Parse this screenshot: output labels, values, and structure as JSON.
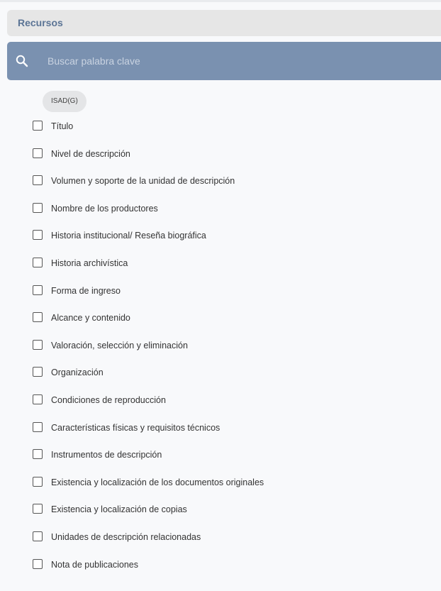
{
  "section": {
    "title": "Recursos"
  },
  "search": {
    "placeholder": "Buscar palabra clave",
    "icon": "search-icon"
  },
  "filter_chip": {
    "label": "ISAD(G)"
  },
  "fields": [
    {
      "label": "Título",
      "checked": false
    },
    {
      "label": "Nivel de descripción",
      "checked": false
    },
    {
      "label": "Volumen y soporte de la unidad de descripción",
      "checked": false
    },
    {
      "label": "Nombre de los productores",
      "checked": false
    },
    {
      "label": "Historia institucional/ Reseña biográfica",
      "checked": false
    },
    {
      "label": "Historia archivística",
      "checked": false
    },
    {
      "label": "Forma de ingreso",
      "checked": false
    },
    {
      "label": "Alcance y contenido",
      "checked": false
    },
    {
      "label": "Valoración, selección y eliminación",
      "checked": false
    },
    {
      "label": "Organización",
      "checked": false
    },
    {
      "label": "Condiciones de reproducción",
      "checked": false
    },
    {
      "label": "Características físicas y requisitos técnicos",
      "checked": false
    },
    {
      "label": "Instrumentos de descripción",
      "checked": false
    },
    {
      "label": "Existencia y localización de los documentos originales",
      "checked": false
    },
    {
      "label": "Existencia y localización de copias",
      "checked": false
    },
    {
      "label": "Unidades de descripción relacionadas",
      "checked": false
    },
    {
      "label": "Nota de publicaciones",
      "checked": false
    }
  ],
  "colors": {
    "header_text": "#5b7495",
    "search_bar": "#7a91b0",
    "chip_bg": "#e4e5e7"
  }
}
